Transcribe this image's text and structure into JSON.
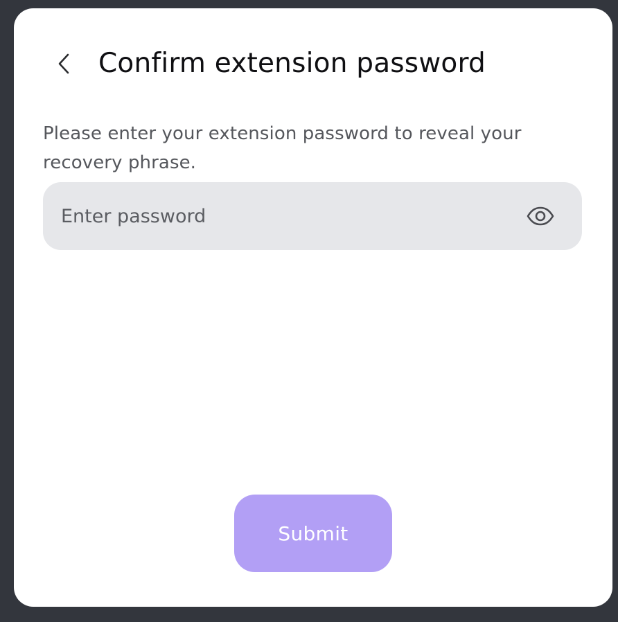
{
  "dialog": {
    "title": "Confirm extension password",
    "description": "Please enter your extension password to reveal your recovery phrase.",
    "back_icon": "chevron-left-icon"
  },
  "password": {
    "placeholder": "Enter password",
    "value": "",
    "toggle_icon": "eye-icon"
  },
  "actions": {
    "submit_label": "Submit"
  },
  "colors": {
    "backdrop": "#33363d",
    "dialog_bg": "#ffffff",
    "input_bg": "#e6e7ea",
    "submit_bg": "#b29ff5",
    "submit_text": "#ffffff",
    "title_text": "#0f0f12",
    "body_text": "#55575c"
  }
}
